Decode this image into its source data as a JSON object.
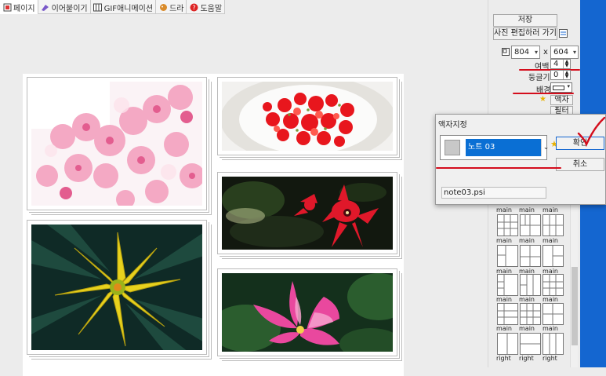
{
  "tabs": [
    {
      "label": "페이지",
      "icon": "page-icon",
      "active": true
    },
    {
      "label": "이어붙이기",
      "icon": "attach-icon",
      "active": false
    },
    {
      "label": "GIF애니메이션",
      "icon": "gif-icon",
      "active": false
    },
    {
      "label": "드라",
      "icon": "brush-icon",
      "active": false
    },
    {
      "label": "도움말",
      "icon": "help-icon",
      "active": false
    }
  ],
  "panel": {
    "save_label": "저장",
    "edit_photo_label": "사진 편집하러 가기",
    "width_value": "804",
    "times_sign": "x",
    "height_value": "604",
    "margin_label": "여백",
    "margin_value": "4",
    "round_label": "둥글기",
    "round_value": "0",
    "bg_label": "배경",
    "frame_label": "액자",
    "filter_label": "필터"
  },
  "dialog": {
    "title": "액자지정",
    "selected_value": "노트 03",
    "ok_label": "확인",
    "cancel_label": "취소",
    "filename": "note03.psi"
  },
  "thumbs": {
    "row_labels": [
      "main",
      "main",
      "main"
    ],
    "labels": [
      [
        "main",
        "main",
        "main"
      ],
      [
        "main",
        "main",
        "main"
      ],
      [
        "main",
        "main",
        "main"
      ],
      [
        "main",
        "main",
        "main"
      ],
      [
        "main",
        "right",
        "right"
      ],
      [
        "right",
        "right",
        "right"
      ]
    ]
  },
  "colors": {
    "accent_blue": "#1466d0",
    "annotation_red": "#d40d1c",
    "selection_blue": "#0a6fd4"
  }
}
